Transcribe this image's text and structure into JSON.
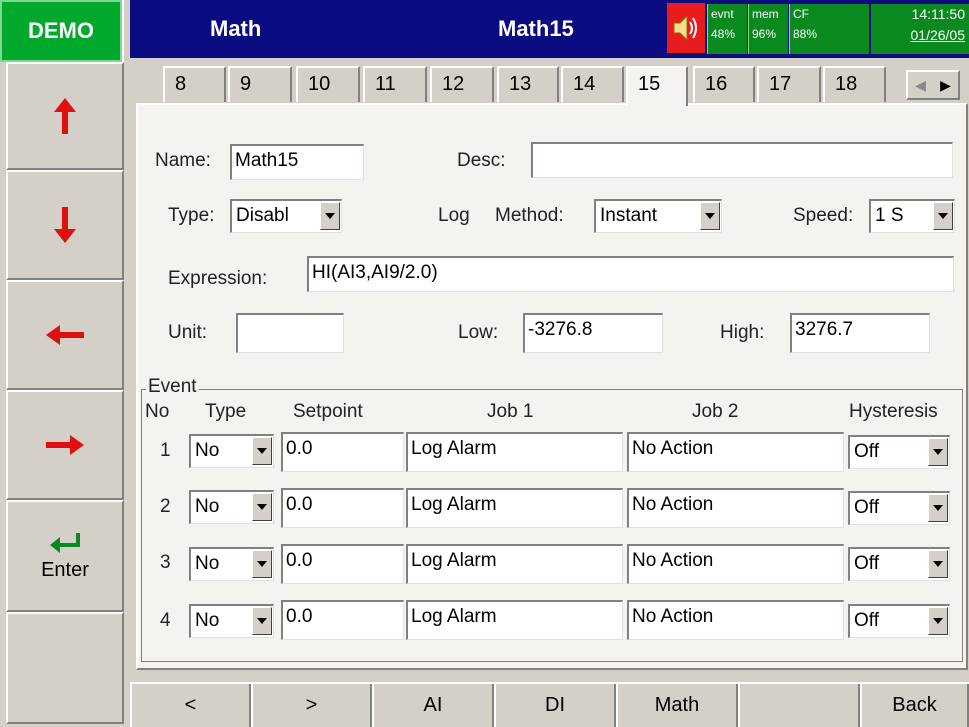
{
  "brand": {
    "label": "DEMO"
  },
  "nav": {
    "buttons": [
      {
        "name": "up",
        "icon": "arrow-up-icon",
        "label": ""
      },
      {
        "name": "down",
        "icon": "arrow-down-icon",
        "label": ""
      },
      {
        "name": "left",
        "icon": "arrow-left-icon",
        "label": ""
      },
      {
        "name": "right",
        "icon": "arrow-right-icon",
        "label": ""
      },
      {
        "name": "enter",
        "icon": "enter-icon",
        "label": "Enter"
      },
      {
        "name": "blank",
        "icon": "",
        "label": ""
      }
    ]
  },
  "header": {
    "title": "Math",
    "page": "Math15",
    "speaker_icon": "speaker-icon",
    "status": [
      {
        "label": "evnt",
        "value": "48%"
      },
      {
        "label": "mem",
        "value": "96%"
      },
      {
        "label": "CF",
        "value": "88%"
      }
    ],
    "time": "14:11:50",
    "date": "01/26/05"
  },
  "tabs": {
    "items": [
      "8",
      "9",
      "10",
      "11",
      "12",
      "13",
      "14",
      "15",
      "16",
      "17",
      "18"
    ],
    "active": "15",
    "scroll_left": "◀",
    "scroll_right": "▶"
  },
  "form": {
    "name_label": "Name:",
    "name_value": "Math15",
    "desc_label": "Desc:",
    "desc_value": "",
    "type_label": "Type:",
    "type_value": "Disabl",
    "log_label": "Log",
    "method_label": "Method:",
    "method_value": "Instant",
    "speed_label": "Speed:",
    "speed_value": "1 S",
    "expression_label": "Expression:",
    "expression_value": "HI(AI3,AI9/2.0)",
    "unit_label": "Unit:",
    "unit_value": "",
    "low_label": "Low:",
    "low_value": "-3276.8",
    "high_label": "High:",
    "high_value": "3276.7"
  },
  "event": {
    "legend": "Event",
    "headers": {
      "no": "No",
      "type": "Type",
      "setpoint": "Setpoint",
      "job1": "Job 1",
      "job2": "Job 2",
      "hysteresis": "Hysteresis"
    },
    "rows": [
      {
        "no": "1",
        "type": "No",
        "setpoint": "0.0",
        "job1": "Log Alarm",
        "job2": "No Action",
        "hysteresis": "Off"
      },
      {
        "no": "2",
        "type": "No",
        "setpoint": "0.0",
        "job1": "Log Alarm",
        "job2": "No Action",
        "hysteresis": "Off"
      },
      {
        "no": "3",
        "type": "No",
        "setpoint": "0.0",
        "job1": "Log Alarm",
        "job2": "No Action",
        "hysteresis": "Off"
      },
      {
        "no": "4",
        "type": "No",
        "setpoint": "0.0",
        "job1": "Log Alarm",
        "job2": "No Action",
        "hysteresis": "Off"
      }
    ]
  },
  "bottom": {
    "buttons": [
      "<",
      ">",
      "AI",
      "DI",
      "Math",
      "",
      "Back"
    ]
  },
  "colors": {
    "brand_green": "#00a82c",
    "header_blue": "#0c0c82",
    "status_green": "#0a8a1e",
    "speaker_red": "#e81c1c",
    "arrow_red": "#e01010",
    "enter_green": "#0a8a1e"
  }
}
